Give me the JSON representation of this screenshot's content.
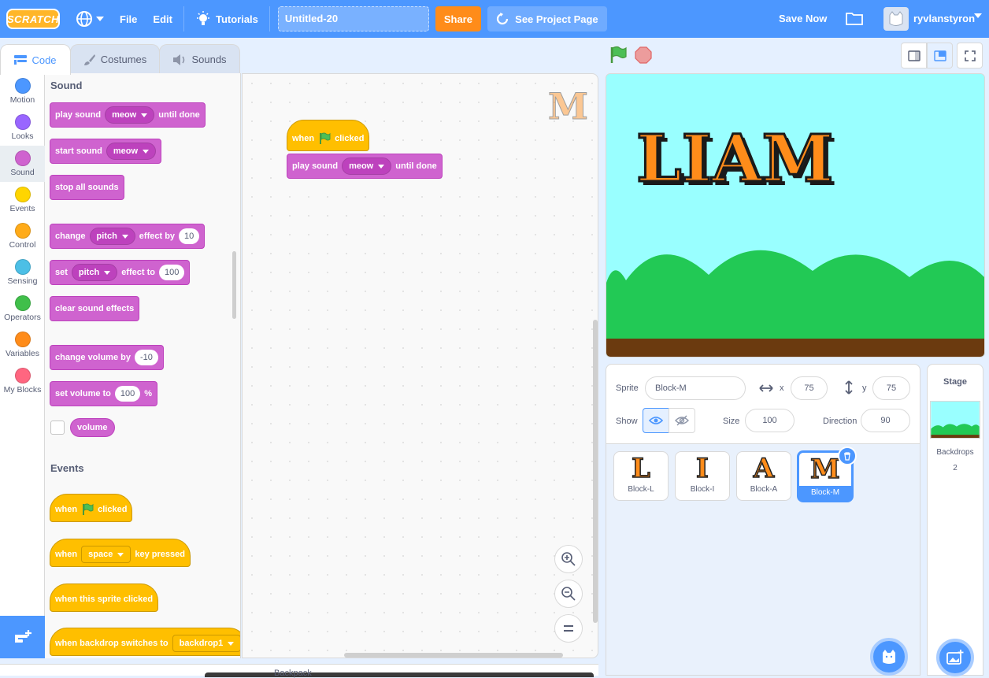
{
  "menubar": {
    "logo": "SCRATCH",
    "file": "File",
    "edit": "Edit",
    "tutorials": "Tutorials",
    "project_title": "Untitled-20",
    "share": "Share",
    "see_project_page": "See Project Page",
    "save_now": "Save Now",
    "username": "ryvlanstyron"
  },
  "tabs": {
    "code": "Code",
    "costumes": "Costumes",
    "sounds": "Sounds"
  },
  "categories": [
    {
      "label": "Motion",
      "color": "#4c97ff"
    },
    {
      "label": "Looks",
      "color": "#9966ff"
    },
    {
      "label": "Sound",
      "color": "#cf63cf"
    },
    {
      "label": "Events",
      "color": "#ffd500"
    },
    {
      "label": "Control",
      "color": "#ffab19"
    },
    {
      "label": "Sensing",
      "color": "#4cbfe6"
    },
    {
      "label": "Operators",
      "color": "#40bf4a"
    },
    {
      "label": "Variables",
      "color": "#ff8c1a"
    },
    {
      "label": "My Blocks",
      "color": "#ff6680"
    }
  ],
  "palette": {
    "sound_title": "Sound",
    "play_sound": {
      "a": "play sound",
      "menu": "meow",
      "b": "until done"
    },
    "start_sound": {
      "a": "start sound",
      "menu": "meow"
    },
    "stop_all": "stop all sounds",
    "change_effect": {
      "a": "change",
      "menu": "pitch",
      "b": "effect by",
      "val": "10"
    },
    "set_effect": {
      "a": "set",
      "menu": "pitch",
      "b": "effect to",
      "val": "100"
    },
    "clear_effects": "clear sound effects",
    "change_volume": {
      "a": "change volume by",
      "val": "-10"
    },
    "set_volume": {
      "a": "set volume to",
      "val": "100",
      "b": "%"
    },
    "volume": "volume",
    "events_title": "Events",
    "when_flag": {
      "a": "when",
      "b": "clicked"
    },
    "when_key": {
      "a": "when",
      "menu": "space",
      "b": "key pressed"
    },
    "when_sprite_clicked": "when this sprite clicked",
    "when_backdrop": {
      "a": "when backdrop switches to",
      "menu": "backdrop1"
    }
  },
  "script": {
    "hat": {
      "a": "when",
      "b": "clicked"
    },
    "play": {
      "a": "play sound",
      "menu": "meow",
      "b": "until done"
    }
  },
  "stage_text": "LIAM",
  "sprite_info": {
    "sprite_label": "Sprite",
    "sprite_name": "Block-M",
    "x_label": "x",
    "x": "75",
    "y_label": "y",
    "y": "75",
    "show_label": "Show",
    "size_label": "Size",
    "size": "100",
    "direction_label": "Direction",
    "direction": "90"
  },
  "sprites": [
    {
      "icon": "L",
      "name": "Block-L"
    },
    {
      "icon": "I",
      "name": "Block-I"
    },
    {
      "icon": "A",
      "name": "Block-A"
    },
    {
      "icon": "M",
      "name": "Block-M"
    }
  ],
  "stage_panel": {
    "title": "Stage",
    "backdrops_label": "Backdrops",
    "backdrops_count": "2"
  },
  "bottom_label": "Backpack"
}
